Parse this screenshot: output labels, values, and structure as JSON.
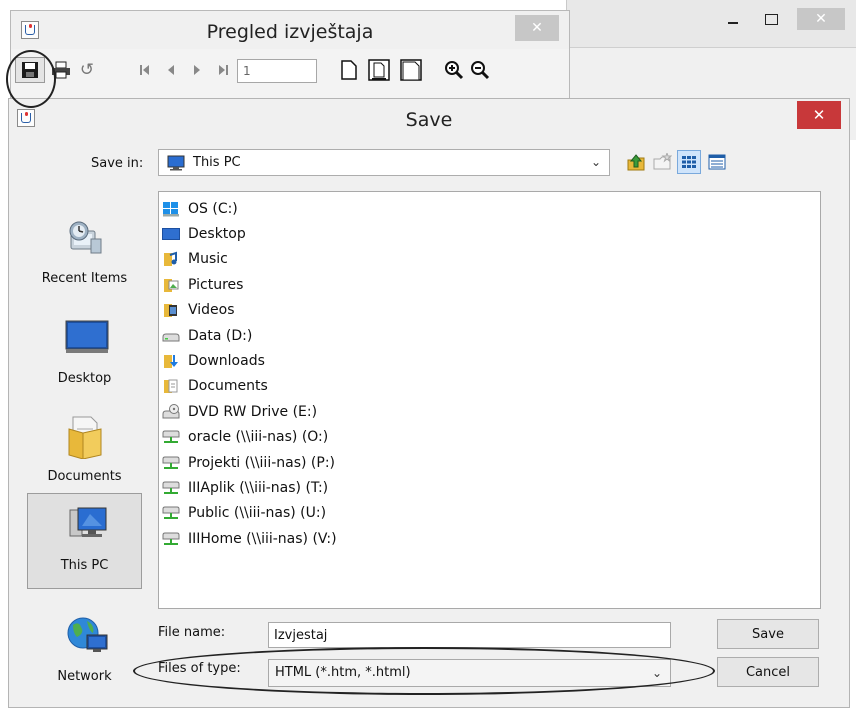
{
  "back_window": {
    "close_glyph": "✕"
  },
  "preview_window": {
    "title": "Pregled izvještaja",
    "close_glyph": "✕",
    "toolbar": {
      "page_number": "1",
      "refresh_glyph": "↺"
    }
  },
  "save_dialog": {
    "title": "Save",
    "close_glyph": "✕",
    "save_in": {
      "label": "Save in:",
      "value": "This PC"
    },
    "places": [
      {
        "label": "Recent Items"
      },
      {
        "label": "Desktop"
      },
      {
        "label": "Documents"
      },
      {
        "label": "This PC",
        "selected": true
      },
      {
        "label": "Network"
      }
    ],
    "files": [
      {
        "name": "OS (C:)",
        "icon": "windows-drive-icon"
      },
      {
        "name": "Desktop",
        "icon": "desktop-folder-icon"
      },
      {
        "name": "Music",
        "icon": "music-folder-icon"
      },
      {
        "name": "Pictures",
        "icon": "pictures-folder-icon"
      },
      {
        "name": "Videos",
        "icon": "videos-folder-icon"
      },
      {
        "name": "Data (D:)",
        "icon": "drive-icon"
      },
      {
        "name": "Downloads",
        "icon": "downloads-folder-icon"
      },
      {
        "name": "Documents",
        "icon": "documents-folder-icon"
      },
      {
        "name": "DVD RW Drive (E:)",
        "icon": "dvd-drive-icon"
      },
      {
        "name": "oracle (\\\\iii-nas) (O:)",
        "icon": "network-drive-icon"
      },
      {
        "name": "Projekti (\\\\iii-nas) (P:)",
        "icon": "network-drive-icon"
      },
      {
        "name": "IIIAplik (\\\\iii-nas) (T:)",
        "icon": "network-drive-icon"
      },
      {
        "name": "Public (\\\\iii-nas) (U:)",
        "icon": "network-drive-icon"
      },
      {
        "name": "IIIHome (\\\\iii-nas) (V:)",
        "icon": "network-drive-icon"
      }
    ],
    "file_name": {
      "label": "File name:",
      "value": "Izvjestaj"
    },
    "file_type": {
      "label": "Files of type:",
      "value": "HTML (*.htm, *.html)"
    },
    "buttons": {
      "save": "Save",
      "cancel": "Cancel"
    },
    "chevron_glyph": "⌄"
  },
  "colors": {
    "close_red": "#c8383a",
    "selection_blue": "#cfe4fb",
    "folder_yellow": "#e8b83a"
  }
}
